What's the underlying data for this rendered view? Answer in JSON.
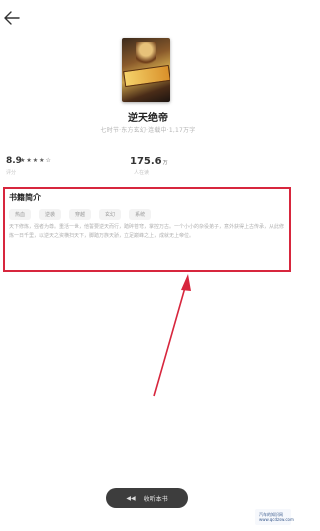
{
  "nav": {
    "back_icon": "arrow-left-icon"
  },
  "book": {
    "title": "逆天绝帝",
    "meta": "七时节·东方玄幻·连载中·1,17万字"
  },
  "stats": {
    "rating": "8.9",
    "stars": "★★★★☆",
    "rating_caption": "评分",
    "count": "175.6",
    "count_unit": "万",
    "count_caption": "人在读"
  },
  "intro": {
    "heading": "书籍简介",
    "tags": [
      "热血",
      "逆袭",
      "穿越",
      "玄幻",
      "系统"
    ],
    "text": "天下修炼，强者为尊。重活一世，他誓要逆天而行，踏碎苍穹，掌控万古。一个小小的杂役弟子，意外获得上古传承，从此修炼一日千里，以逆天之资横扫天下，脚踏万族天骄，立足巅峰之上，成就无上帝位。"
  },
  "bottom": {
    "label": "收听本书"
  },
  "watermark": {
    "line1": "汽车的知识网",
    "line2": "www.qcdzsw.com"
  },
  "colors": {
    "highlight": "#d7263d",
    "bottom_bar": "#3d3d3d"
  }
}
